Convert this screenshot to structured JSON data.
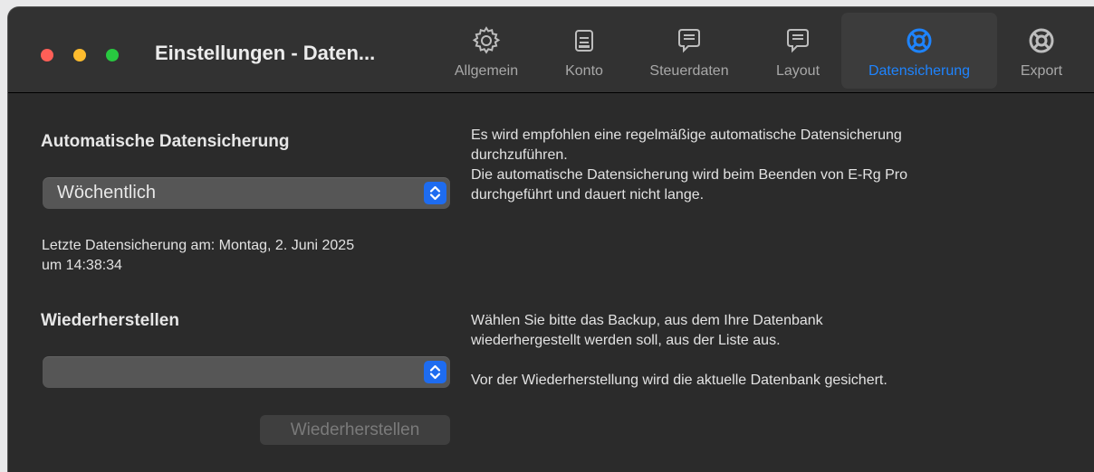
{
  "window": {
    "title": "Einstellungen - Daten..."
  },
  "toolbar": {
    "tabs": [
      {
        "label": "Allgemein",
        "icon": "gear-icon"
      },
      {
        "label": "Konto",
        "icon": "account-card-icon"
      },
      {
        "label": "Steuerdaten",
        "icon": "speech-bubble-icon"
      },
      {
        "label": "Layout",
        "icon": "speech-bubble-icon"
      },
      {
        "label": "Datensicherung",
        "icon": "lifebuoy-icon",
        "active": true
      },
      {
        "label": "Export",
        "icon": "lifebuoy-icon"
      }
    ]
  },
  "auto_backup": {
    "heading": "Automatische Datensicherung",
    "interval_value": "Wöchentlich",
    "last_backup_line1": "Letzte Datensicherung am: Montag, 2. Juni 2025",
    "last_backup_line2": "um 14:38:34",
    "description": [
      "Es wird empfohlen eine regelmäßige automatische Datensicherung",
      "durchzuführen.",
      "Die automatische Datensicherung wird beim Beenden von E-Rg Pro",
      "durchgeführt und dauert nicht lange."
    ]
  },
  "restore": {
    "heading": "Wiederherstellen",
    "backup_value": "",
    "button_label": "Wiederherstellen",
    "description": [
      "Wählen Sie bitte das Backup, aus dem Ihre Datenbank",
      "wiederhergestellt werden soll, aus der Liste aus.",
      "",
      "Vor der Wiederherstellung wird die aktuelle Datenbank gesichert."
    ]
  },
  "colors": {
    "accent": "#1e84ff",
    "stepper": "#1e6cf0",
    "background": "#2b2b2b"
  }
}
